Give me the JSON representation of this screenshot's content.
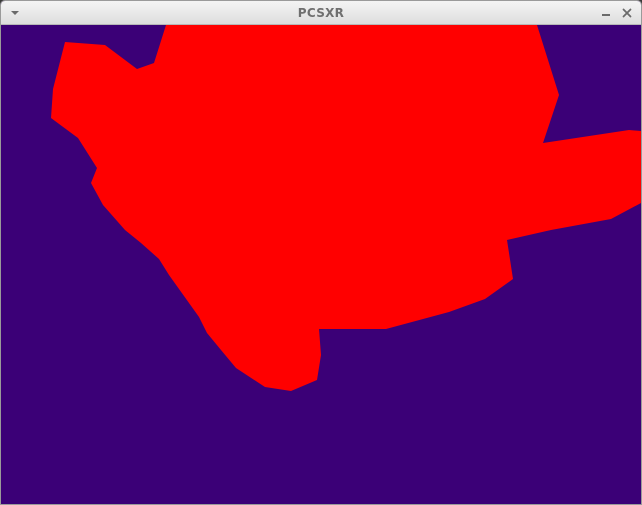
{
  "window": {
    "title": "PCSXR"
  },
  "titlebar_controls": {
    "menu_icon": "chevron-down-icon",
    "minimize_icon": "minimize-icon",
    "close_icon": "close-icon"
  },
  "viewport": {
    "background_color": "#3b0077",
    "shape_color": "#ff0000"
  }
}
